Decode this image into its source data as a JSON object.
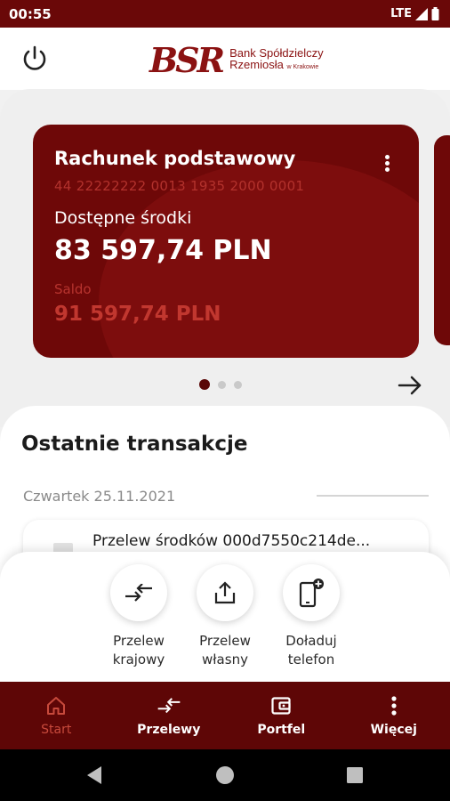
{
  "status_bar": {
    "time": "00:55",
    "network": "LTE"
  },
  "header": {
    "logo_mark": "BSR",
    "logo_line1": "Bank Spółdzielczy",
    "logo_line2": "Rzemiosła",
    "logo_line2_small": "w Krakowie"
  },
  "account_card": {
    "title": "Rachunek podstawowy",
    "iban": "44 22222222 0013 1935 2000 0001",
    "available_label": "Dostępne środki",
    "available_amount": "83 597,74 PLN",
    "saldo_label": "Saldo",
    "saldo_amount": "91 597,74 PLN",
    "pager": {
      "count": 3,
      "active": 1
    }
  },
  "transactions": {
    "heading": "Ostatnie transakcje",
    "date": "Czwartek 25.11.2021",
    "items": [
      {
        "label": "Przelew środków 000d7550c214de..."
      }
    ]
  },
  "quick_actions": [
    {
      "line1": "Przelew",
      "line2": "krajowy",
      "icon": "transfer-arrows-icon"
    },
    {
      "line1": "Przelew",
      "line2": "własny",
      "icon": "upload-icon"
    },
    {
      "line1": "Doładuj",
      "line2": "telefon",
      "icon": "phone-topup-icon"
    }
  ],
  "bottom_nav": [
    {
      "label": "Start",
      "icon": "home-icon",
      "active": true
    },
    {
      "label": "Przelewy",
      "icon": "transfer-arrows-icon",
      "active": false
    },
    {
      "label": "Portfel",
      "icon": "wallet-icon",
      "active": false
    },
    {
      "label": "Więcej",
      "icon": "more-vertical-icon",
      "active": false
    }
  ],
  "colors": {
    "brand_dark": "#5e0606",
    "card": "#6e0808",
    "accent_red": "#c1372f"
  }
}
